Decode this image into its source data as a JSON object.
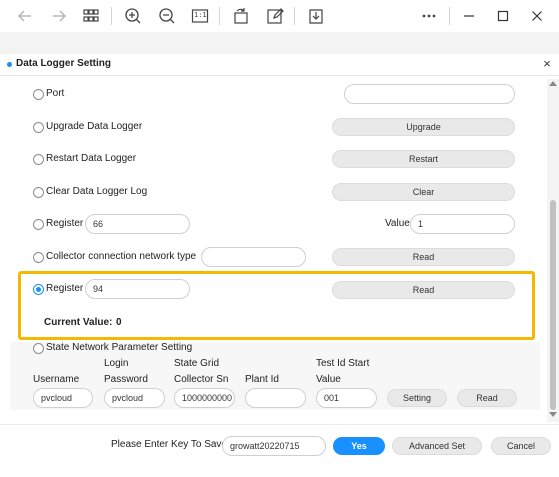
{
  "toolbar": {
    "icons": [
      "arrow-left-icon",
      "arrow-right-icon",
      "grid-icon",
      "zoom-in-icon",
      "zoom-out-icon",
      "actual-size-icon",
      "rotate-icon",
      "edit-icon",
      "save-icon",
      "more-icon",
      "minimize-icon",
      "maximize-icon",
      "close-icon"
    ],
    "actual_size_text": "1:1"
  },
  "dialog": {
    "title": "Data Logger Setting",
    "close": "×"
  },
  "rows": {
    "port": {
      "label": "Port",
      "value": ""
    },
    "upgrade": {
      "label": "Upgrade Data Logger",
      "button": "Upgrade"
    },
    "restart": {
      "label": "Restart Data Logger",
      "button": "Restart"
    },
    "clear": {
      "label": "Clear Data Logger Log",
      "button": "Clear"
    },
    "register1": {
      "label": "Register",
      "value": "66",
      "value_label": "Value",
      "value_input": "1"
    },
    "network": {
      "label": "Collector connection network type",
      "value": "",
      "button": "Read"
    },
    "register2": {
      "label": "Register",
      "value": "94",
      "button": "Read",
      "current_label": "Current Value:",
      "current_value": "0"
    },
    "state_grid": {
      "label": "State Network Parameter Setting",
      "headers": {
        "username": "Username",
        "login_top": "Login",
        "password": "Password",
        "state_grid_top": "State Grid",
        "collector_sn": "Collector Sn",
        "plant_id": "Plant Id",
        "test_id_top": "Test Id Start",
        "value": "Value"
      },
      "inputs": {
        "username": "pvcloud",
        "password": "pvcloud",
        "collector_sn": "1000000000",
        "plant_id": "",
        "value": "001"
      },
      "setting_button": "Setting",
      "read_button": "Read"
    }
  },
  "footer": {
    "prompt": "Please Enter Key To Save",
    "key_value": "growatt20220715",
    "yes": "Yes",
    "advanced": "Advanced Set",
    "cancel": "Cancel"
  },
  "colors": {
    "accent": "#1890ff",
    "highlight": "#f5b800"
  }
}
